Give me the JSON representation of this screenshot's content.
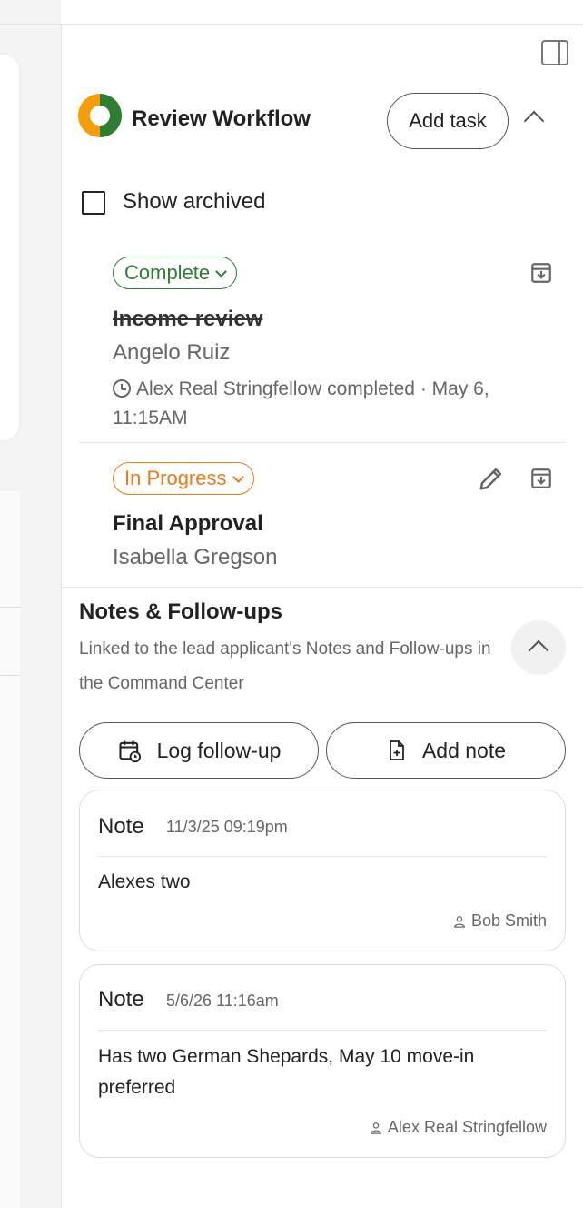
{
  "workflow": {
    "title": "Review Workflow",
    "add_task_label": "Add task",
    "show_archived_label": "Show archived",
    "tasks": [
      {
        "status": "Complete",
        "title": "Income review",
        "assignee": "Angelo Ruiz",
        "meta": "Alex Real Stringfellow completed · May 6, 11:15AM"
      },
      {
        "status": "In Progress",
        "title": "Final Approval",
        "assignee": "Isabella Gregson"
      }
    ]
  },
  "notes": {
    "title": "Notes & Follow-ups",
    "description": "Linked to the lead applicant's Notes and Follow-ups in the Command Center",
    "log_followup_label": "Log follow-up",
    "add_note_label": "Add note",
    "items": [
      {
        "type": "Note",
        "timestamp": "11/3/25 09:19pm",
        "body": "Alexes two",
        "author": "Bob Smith"
      },
      {
        "type": "Note",
        "timestamp": "5/6/26 11:16am",
        "body": "Has two German Shepards, May 10 move-in preferred",
        "author": "Alex Real Stringfellow"
      }
    ]
  },
  "colors": {
    "complete": "#2e7d32",
    "in_progress": "#ea7a1a",
    "logo_orange": "#f59e0b",
    "logo_green": "#2e7d32"
  },
  "icons": {
    "panel_toggle": "sidebar-panel-icon",
    "archive": "archive-download-icon",
    "edit": "pencil-icon",
    "clock": "clock-icon",
    "calendar": "calendar-refresh-icon",
    "file_add": "file-plus-icon",
    "person": "person-icon"
  }
}
